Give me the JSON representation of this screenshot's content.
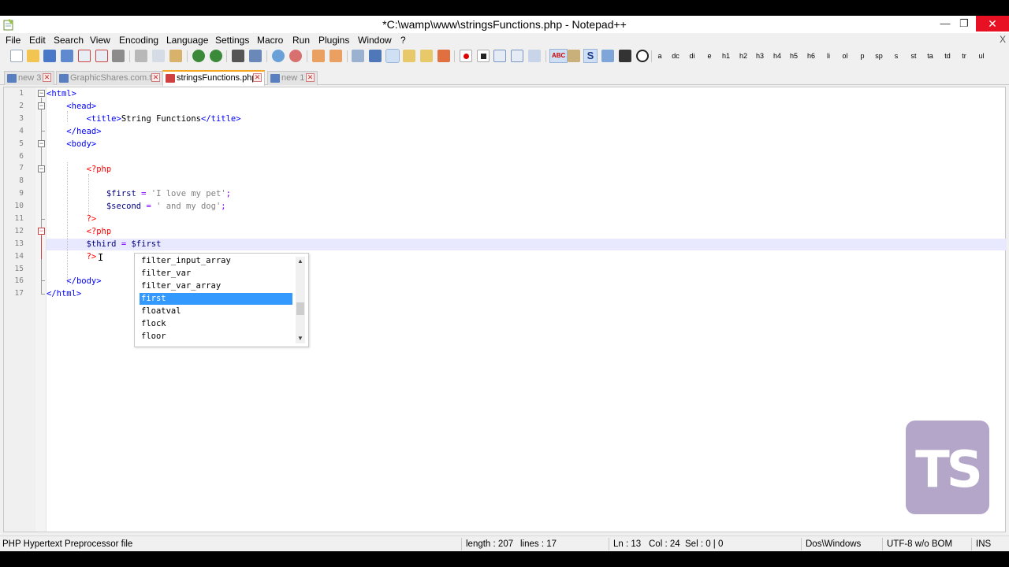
{
  "window": {
    "title": "*C:\\wamp\\www\\stringsFunctions.php - Notepad++",
    "controls": {
      "minimize": "—",
      "maximize": "❐",
      "close": "✕"
    }
  },
  "menu": {
    "items": [
      "File",
      "Edit",
      "Search",
      "View",
      "Encoding",
      "Language",
      "Settings",
      "Macro",
      "Run",
      "Plugins",
      "Window",
      "?"
    ],
    "close_glyph": "X"
  },
  "toolbar": {
    "text_buttons": [
      "a",
      "dc",
      "di",
      "e",
      "h1",
      "h2",
      "h3",
      "h4",
      "h5",
      "h6",
      "li",
      "ol",
      "p",
      "sp",
      "s",
      "st",
      "ta",
      "td",
      "tr",
      "ul"
    ],
    "s_button": "S",
    "abc_button": "ABC"
  },
  "tabs": [
    {
      "label": "new 3",
      "active": false,
      "close": "✕"
    },
    {
      "label": "GraphicShares.com.txt",
      "active": false,
      "close": "✕"
    },
    {
      "label": "stringsFunctions.php",
      "active": true,
      "close": "✕"
    },
    {
      "label": "new 1",
      "active": false,
      "close": "✕"
    }
  ],
  "editor": {
    "line_numbers": [
      "1",
      "2",
      "3",
      "4",
      "5",
      "6",
      "7",
      "8",
      "9",
      "10",
      "11",
      "12",
      "13",
      "14",
      "15",
      "16",
      "17"
    ],
    "current_line": 13,
    "lines": {
      "l1": {
        "a": "<html>"
      },
      "l2": {
        "a": "<head>"
      },
      "l3": {
        "a": "<title>",
        "b": "String Functions",
        "c": "</title>"
      },
      "l4": {
        "a": "</head>"
      },
      "l5": {
        "a": "<body>"
      },
      "l7": {
        "a": "<?php"
      },
      "l9": {
        "a": "$first",
        "b": " = ",
        "c": "'I love my pet'",
        "d": ";"
      },
      "l10": {
        "a": "$second",
        "b": " = ",
        "c": "' and my dog'",
        "d": ";"
      },
      "l11": {
        "a": "?>"
      },
      "l12": {
        "a": "<?php"
      },
      "l13": {
        "a": "$third",
        "b": " = ",
        "c": "$first"
      },
      "l14": {
        "a": "?>"
      },
      "l16": {
        "a": "</body>"
      },
      "l17": {
        "a": "</html>"
      }
    },
    "cursor_glyph": "I"
  },
  "autocomplete": {
    "items": [
      "filter_input_array",
      "filter_var",
      "filter_var_array",
      "first",
      "floatval",
      "flock",
      "floor"
    ],
    "selected_index": 3,
    "scroll_up": "▲",
    "scroll_down": "▼"
  },
  "watermark": {
    "text": "TS"
  },
  "statusbar": {
    "file_type": "PHP Hypertext Preprocessor file",
    "length": "length : 207",
    "lines": "lines : 17",
    "ln": "Ln : 13",
    "col": "Col : 24",
    "sel": "Sel : 0 | 0",
    "eol": "Dos\\Windows",
    "encoding": "UTF-8 w/o BOM",
    "mode": "INS"
  },
  "colors": {
    "tag": "#0000ff",
    "php_delim": "#ff0000",
    "variable": "#000080",
    "string": "#808080",
    "operator": "#8000ff",
    "current_line": "#e8e8ff",
    "selection": "#3399ff",
    "active_tab_accent": "#f5a623",
    "watermark_bg": "#b3a6c9"
  }
}
